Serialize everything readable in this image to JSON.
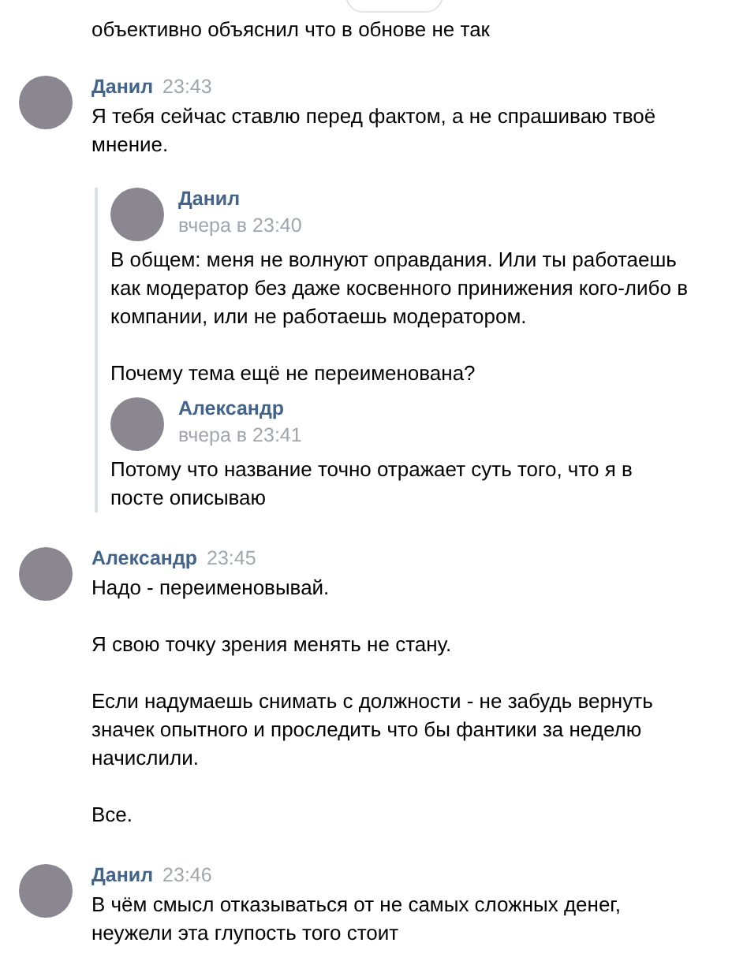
{
  "date_divider": {
    "partial": true
  },
  "messages": [
    {
      "paragraphs": [
        "объективно объяснил что в обнове не так"
      ]
    },
    {
      "author": "Данил",
      "time": "23:43",
      "paragraphs": [
        "Я тебя сейчас ставлю перед фактом, а не спрашиваю твоё мнение."
      ],
      "forwarded": [
        {
          "author": "Данил",
          "date": "вчера в 23:40",
          "paragraphs": [
            "В общем: меня не волнуют оправдания. Или ты работаешь как модератор без даже косвенного принижения кого-либо в компании, или не работаешь модератором.",
            "Почему тема ещё не переименована?"
          ]
        },
        {
          "author": "Александр",
          "date": "вчера в 23:41",
          "paragraphs": [
            "Потому что название точно отражает суть того, что я в посте описываю"
          ]
        }
      ]
    },
    {
      "author": "Александр",
      "time": "23:45",
      "paragraphs": [
        "Надо - переименовывай.",
        "Я свою точку зрения менять не стану.",
        "Если надумаешь снимать с должности - не забудь вернуть значек опытного и проследить что бы фантики за неделю начислили.",
        "Все."
      ]
    },
    {
      "author": "Данил",
      "time": "23:46",
      "paragraphs": [
        "В чём смысл отказываться от не самых сложных денег, неужели эта глупость того стоит"
      ]
    }
  ]
}
